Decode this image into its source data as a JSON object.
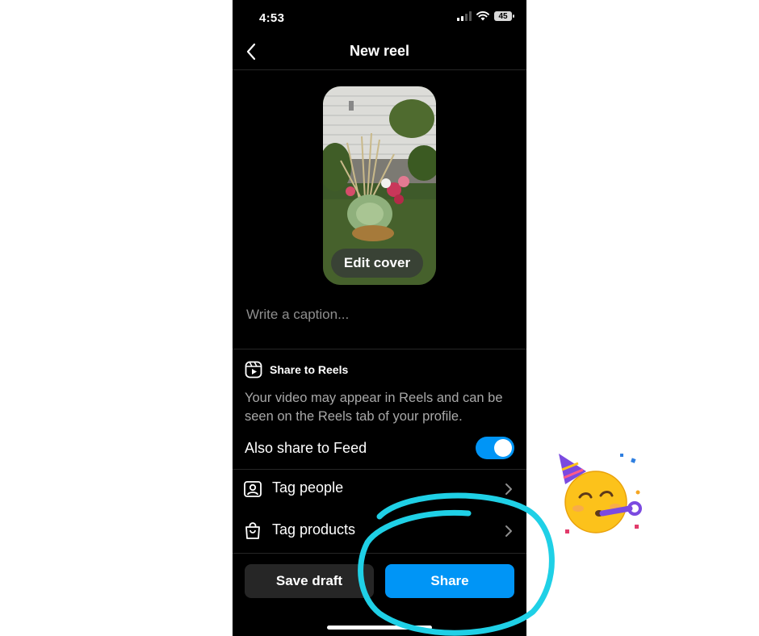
{
  "status_bar": {
    "time": "4:53",
    "battery": "45"
  },
  "header": {
    "title": "New reel"
  },
  "cover": {
    "edit_label": "Edit cover"
  },
  "caption": {
    "placeholder": "Write a caption..."
  },
  "share_to_reels": {
    "label": "Share to Reels",
    "description": "Your video may appear in Reels and can be seen on the Reels tab of your profile."
  },
  "also_share_feed": {
    "label": "Also share to Feed",
    "enabled": true
  },
  "rows": [
    {
      "label": "Tag people",
      "icon": "tag-people-icon"
    },
    {
      "label": "Tag products",
      "icon": "shopping-bag-icon"
    }
  ],
  "buttons": {
    "save_draft": "Save draft",
    "share": "Share"
  },
  "colors": {
    "accent": "#0095f6",
    "annotation_circle": "#1fd0e6",
    "background": "#000000"
  }
}
